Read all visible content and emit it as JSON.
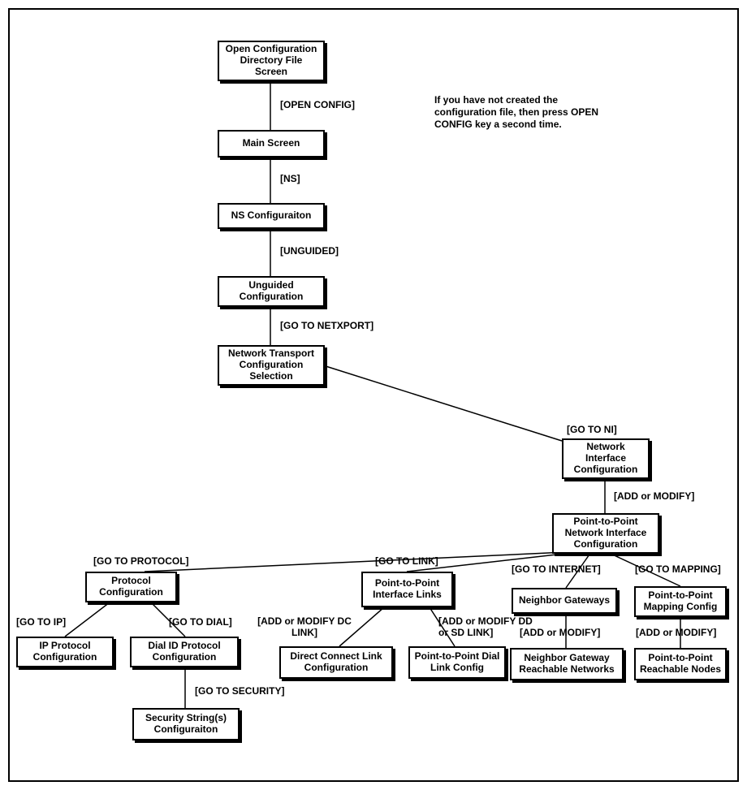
{
  "note": "If you have not created the configuration file, then press OPEN CONFIG key a second time.",
  "boxes": {
    "open_cfg": "Open Configuration Directory File Screen",
    "main_screen": "Main Screen",
    "ns_cfg": "NS Configuraiton",
    "unguided": "Unguided Configuration",
    "netxport": "Network Transport Configuration Selection",
    "ni_cfg": "Network Interface Configuration",
    "ptp_ni_cfg": "Point-to-Point Network Interface Configuration",
    "protocol": "Protocol Configuration",
    "ptp_links": "Point-to-Point Interface Links",
    "neighbor_gw": "Neighbor Gateways",
    "ptp_mapping": "Point-to-Point Mapping Config",
    "ip_protocol": "IP Protocol Configuration",
    "dial_id": "Dial ID Protocol Configuration",
    "direct_connect": "Direct Connect Link Configuration",
    "ptp_dial": "Point-to-Point Dial Link Config",
    "neighbor_reach": "Neighbor Gateway Reachable Networks",
    "ptp_reach": "Point-to-Point Reachable Nodes",
    "security": "Security String(s) Configuraiton"
  },
  "edges": {
    "open_config": "[OPEN CONFIG]",
    "ns": "[NS]",
    "unguided": "[UNGUIDED]",
    "goto_netxport": "[GO TO NETXPORT]",
    "goto_ni": "[GO TO NI]",
    "add_mod": "[ADD or MODIFY]",
    "goto_protocol": "[GO TO PROTOCOL]",
    "goto_link": "[GO TO LINK]",
    "goto_internet": "[GO TO INTERNET]",
    "goto_mapping": "[GO TO MAPPING]",
    "goto_ip": "[GO TO IP]",
    "goto_dial": "[GO TO DIAL]",
    "add_mod_dc": "[ADD or MODIFY DC LINK]",
    "add_mod_dd": "[ADD or MODIFY DD or SD LINK]",
    "add_mod2": "[ADD or MODIFY]",
    "add_mod3": "[ADD or MODIFY]",
    "goto_security": "[GO TO SECURITY]"
  }
}
